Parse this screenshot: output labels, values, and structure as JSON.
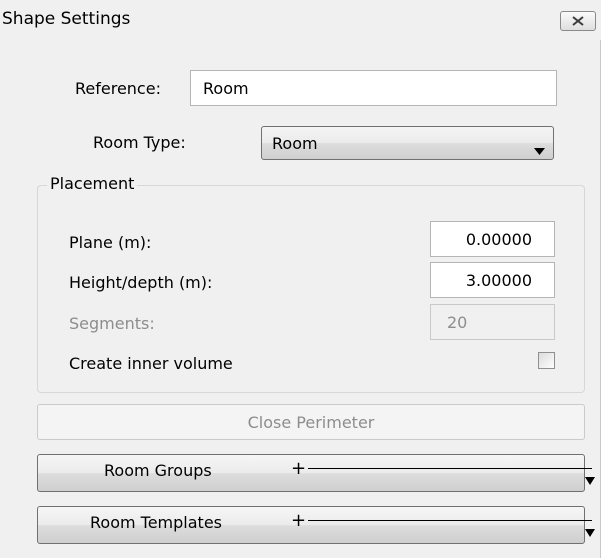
{
  "window": {
    "title": "Shape Settings"
  },
  "reference": {
    "label": "Reference:",
    "value": "Room"
  },
  "room_type": {
    "label": "Room Type:",
    "selected": "Room"
  },
  "placement": {
    "legend": "Placement",
    "plane_label": "Plane (m):",
    "plane_value": "0.00000",
    "height_label": "Height/depth (m):",
    "height_value": "3.00000",
    "segments_label": "Segments:",
    "segments_value": "20",
    "inner_volume_label": "Create inner volume",
    "inner_volume_checked": false
  },
  "buttons": {
    "close_perimeter": "Close Perimeter",
    "room_groups": "Room Groups",
    "room_templates": "Room Templates",
    "plus": "+"
  },
  "colors": {
    "window_bg": "#f0f0f0",
    "disabled_text": "#8d8d8d"
  },
  "icons": {
    "close": "close-x-icon",
    "dropdown": "triangle-down-icon",
    "expand": "arrow-down-icon"
  }
}
